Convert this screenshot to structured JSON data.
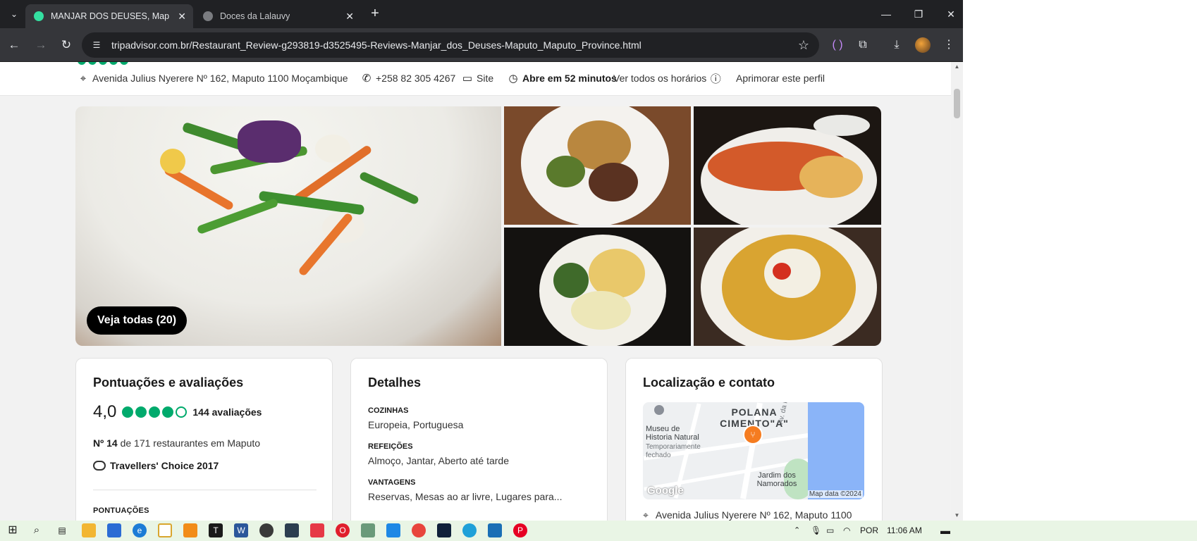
{
  "browser": {
    "tabs": [
      {
        "title": "MANJAR DOS DEUSES, Maputo",
        "active": true
      },
      {
        "title": "Doces da Lalauvy",
        "active": false
      }
    ],
    "url": "tripadvisor.com.br/Restaurant_Review-g293819-d3525495-Reviews-Manjar_dos_Deuses-Maputo_Maputo_Province.html"
  },
  "info_bar": {
    "address": "Avenida Julius Nyerere Nº 162, Maputo 1100 Moçambique",
    "phone": "+258 82 305 4267",
    "site_label": "Site",
    "open_status": "Abre em 52 minutos",
    "hours_link": "Ver todos os horários",
    "improve_link": "Aprimorar este perfil"
  },
  "gallery": {
    "view_all_label": "Veja todas (20)"
  },
  "ratings": {
    "heading": "Pontuações e avaliações",
    "score": "4,0",
    "bubbles_filled": 4,
    "bubbles_total": 5,
    "review_count": "144 avaliações",
    "rank_prefix": "Nº 14",
    "rank_suffix": "de 171 restaurantes em Maputo",
    "award": "Travellers' Choice 2017",
    "scores_label": "PONTUAÇÕES"
  },
  "details": {
    "heading": "Detalhes",
    "sections": [
      {
        "label": "COZINHAS",
        "value": "Europeia, Portuguesa"
      },
      {
        "label": "REFEIÇÕES",
        "value": "Almoço, Jantar, Aberto até tarde"
      },
      {
        "label": "VANTAGENS",
        "value": "Reservas, Mesas ao ar livre, Lugares para..."
      }
    ]
  },
  "location": {
    "heading": "Localização e contato",
    "map": {
      "neighborhood": "POLANA CIMENTO\"A\"",
      "museum": "Museu de Historia Natural",
      "museum_status": "Temporariamente fechado",
      "street": "Av. da Marginal",
      "park": "Jardim dos Namorados",
      "logo": "Google",
      "attribution": "Map data ©2024"
    },
    "address": "Avenida Julius Nyerere Nº 162, Maputo 1100"
  },
  "taskbar": {
    "language": "POR",
    "time": "11:06 AM"
  },
  "colors": {
    "accent_green": "#00aa6c",
    "map_pin": "#f57c20",
    "chrome_dark": "#202124"
  }
}
